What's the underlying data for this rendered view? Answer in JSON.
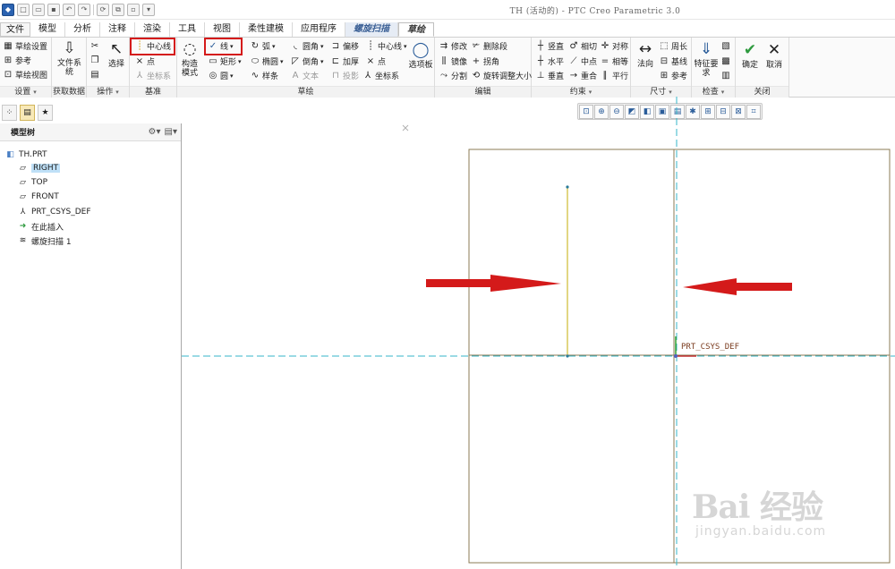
{
  "window": {
    "title": "TH (活动的) - PTC Creo Parametric 3.0"
  },
  "tabs": [
    "文件",
    "模型",
    "分析",
    "注释",
    "渲染",
    "工具",
    "视图",
    "柔性建模",
    "应用程序",
    "螺旋扫描",
    "草绘"
  ],
  "ribbon": {
    "setup": {
      "items": [
        "草绘设置",
        "参考",
        "草绘视图"
      ],
      "label": "设置"
    },
    "getdata": {
      "file_system": "文件系统",
      "label": "获取数据"
    },
    "operations": {
      "select": "选择",
      "label": "操作"
    },
    "datum": {
      "centerline": "中心线",
      "point": "点",
      "csys": "坐标系",
      "label": "基准"
    },
    "construction": "构造模式",
    "sketch": {
      "line": "线",
      "rectangle": "矩形",
      "circle": "圆",
      "arc": "弧",
      "ellipse": "椭圆",
      "spline": "样条",
      "fillet": "圆角",
      "chamfer": "倒角",
      "text": "文本",
      "offset": "偏移",
      "thicken": "加厚",
      "project": "投影",
      "centerline": "中心线",
      "point": "点",
      "csys": "坐标系",
      "palette": "选项板",
      "label": "草绘"
    },
    "edit": {
      "modify": "修改",
      "delete_segment": "删除段",
      "mirror": "镜像",
      "corner": "拐角",
      "divide": "分割",
      "rotate_resize": "旋转调整大小",
      "label": "编辑"
    },
    "constrain": {
      "items": [
        "竖直",
        "相切",
        "对称",
        "水平",
        "中点",
        "相等",
        "垂直",
        "重合",
        "平行"
      ],
      "label": "约束"
    },
    "dimension": {
      "normal": "法向",
      "perimeter": "周长",
      "baseline": "基线",
      "reference": "参考",
      "label": "尺寸"
    },
    "inspect": {
      "feature_req": "特征要求",
      "label": "检查"
    },
    "close": {
      "ok": "确定",
      "cancel": "取消",
      "label": "关闭"
    }
  },
  "model_tree": {
    "title": "模型树",
    "items": [
      "TH.PRT",
      "RIGHT",
      "TOP",
      "FRONT",
      "PRT_CSYS_DEF",
      "在此插入",
      "螺旋扫描 1"
    ]
  },
  "canvas": {
    "csys_label": "PRT_CSYS_DEF"
  },
  "watermark": {
    "logo": "Bai 经验",
    "url": "jingyan.baidu.com"
  },
  "colors": {
    "annotation_red": "#d41a1a",
    "ok_green": "#2e9a3e",
    "selection_blue": "#bfe0f7",
    "sketch_line": "#d8c85a",
    "axis_cyan": "#36b6c8",
    "frame": "#8b7b54"
  }
}
